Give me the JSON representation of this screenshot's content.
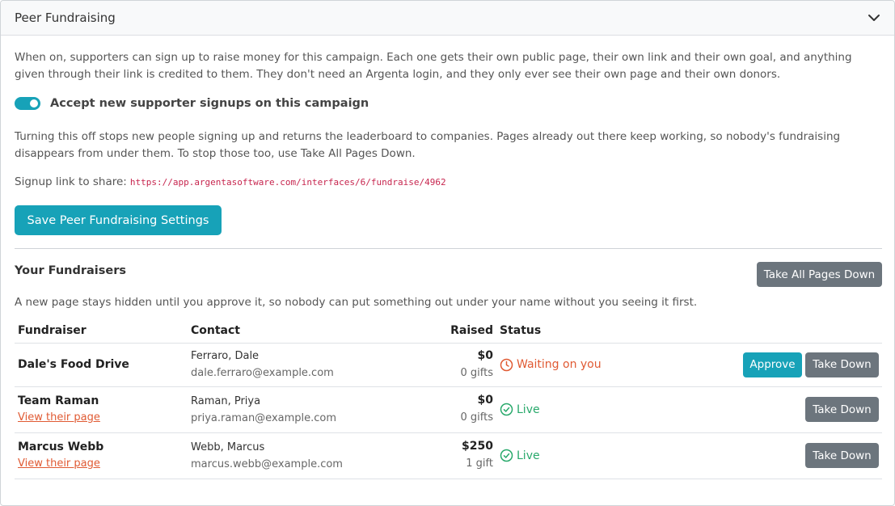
{
  "panel": {
    "title": "Peer Fundraising"
  },
  "intro": "When on, supporters can sign up to raise money for this campaign. Each one gets their own public page, their own link and their own goal, and anything given through their link is credited to them. They don't need an Argenta login, and they only ever see their own page and their own donors.",
  "toggle": {
    "label": "Accept new supporter signups on this campaign",
    "checked": true
  },
  "toggle_help": "Turning this off stops new people signing up and returns the leaderboard to companies. Pages already out there keep working, so nobody's fundraising disappears from under them. To stop those too, use Take All Pages Down.",
  "signup": {
    "label": "Signup link to share:",
    "url": "https://app.argentasoftware.com/interfaces/6/fundraise/4962"
  },
  "save_button": "Save Peer Fundraising Settings",
  "fundraisers": {
    "title": "Your Fundraisers",
    "take_all_button": "Take All Pages Down",
    "help": "A new page stays hidden until you approve it, so nobody can put something out under your name without you seeing it first.",
    "columns": [
      "Fundraiser",
      "Contact",
      "Raised",
      "Status",
      ""
    ],
    "rows": [
      {
        "name": "Dale's Food Drive",
        "link": "",
        "contact_name": "Ferraro, Dale",
        "contact_email": "dale.ferraro@example.com",
        "raised": "$0",
        "gifts": "0 gifts",
        "status": "Waiting on you",
        "approve": "Approve",
        "take_down": "Take Down"
      },
      {
        "name": "Team Raman",
        "link": "View their page",
        "contact_name": "Raman, Priya",
        "contact_email": "priya.raman@example.com",
        "raised": "$0",
        "gifts": "0 gifts",
        "status": "Live",
        "take_down": "Take Down"
      },
      {
        "name": "Marcus Webb",
        "link": "View their page",
        "contact_name": "Webb, Marcus",
        "contact_email": "marcus.webb@example.com",
        "raised": "$250",
        "gifts": "1 gift",
        "status": "Live",
        "take_down": "Take Down"
      }
    ]
  },
  "colors": {
    "accent": "#17a2b8",
    "secondary": "#6c757d",
    "waiting": "#e05a33",
    "live": "#28a96b"
  },
  "icons": {
    "header": "chevron-down-icon",
    "waiting": "clock-icon",
    "live": "check-circle-icon"
  }
}
